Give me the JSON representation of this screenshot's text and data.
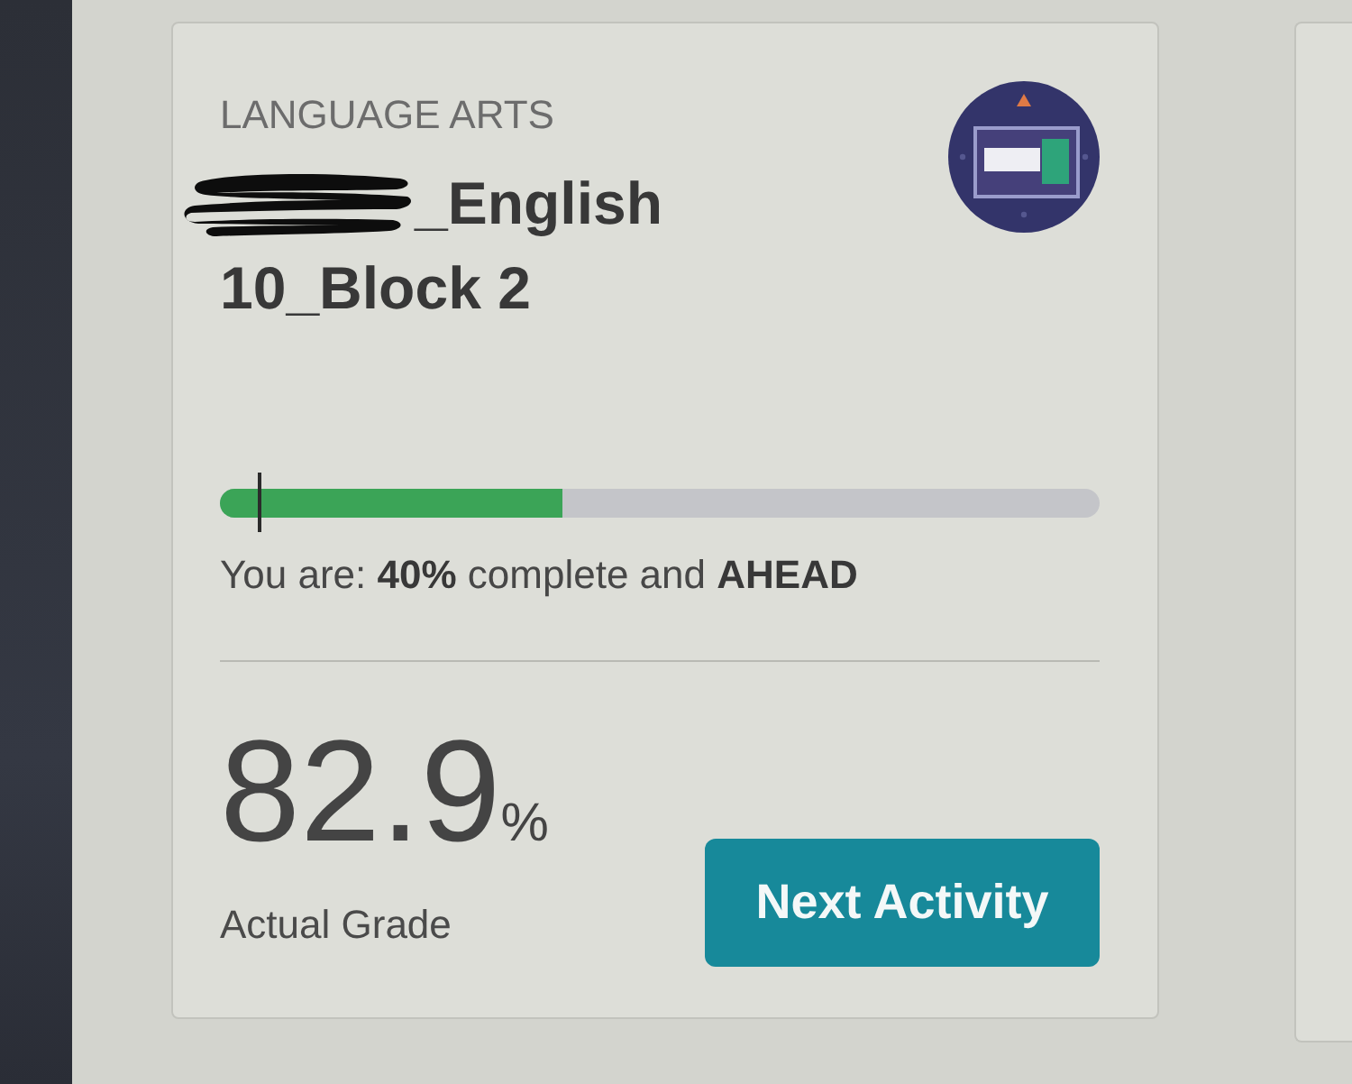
{
  "course": {
    "category": "LANGUAGE ARTS",
    "title_lines": [
      "_English",
      "10_Block 2"
    ],
    "redacted": true
  },
  "progress": {
    "level": 0.39,
    "pace_marker": {
      "level": 0.045
    },
    "status": "You are: **40%** complete and **AHEAD**"
  },
  "grade": {
    "value": "82.9",
    "unit": "%",
    "label": "Actual Grade"
  },
  "button": {
    "label": "Next Activity"
  }
}
